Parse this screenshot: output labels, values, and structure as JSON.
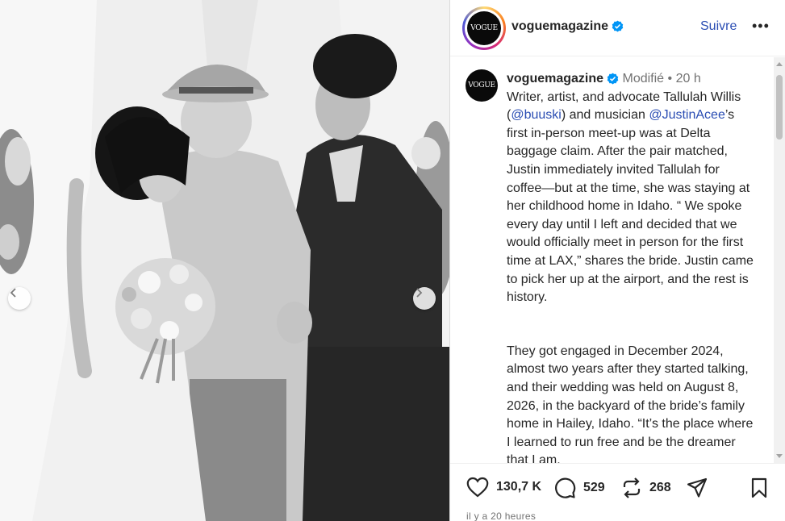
{
  "header": {
    "avatar_text": "VOGUE",
    "username": "voguemagazine",
    "follow_label": "Suivre",
    "more_label": "•••"
  },
  "caption": {
    "avatar_text": "VOGUE",
    "username": "voguemagazine",
    "edited_label": "Modifié",
    "separator": "•",
    "time_ago": "20 h",
    "p1_a": "Writer, artist, and advocate Tallulah Willis (",
    "mention1": "@buuski",
    "p1_b": ") and musician ",
    "mention2": "@JustinAcee",
    "p1_c": "’s first in-person meet-up was at Delta baggage claim. After the pair matched, Justin immediately invited Tallulah for coffee—but at the time, she was staying at her childhood home in Idaho. “ We spoke every day until I left and decided that we would officially meet in person for the first time at LAX,” shares the bride. Justin came to pick her up at the airport, and the rest is history.",
    "p2": "They got engaged in December 2024, almost two years after they started talking, and their wedding was held on August 8, 2026, in the backyard of the bride’s family home in Hailey, Idaho. “It’s the place where I learned to run free and be the dreamer that I am."
  },
  "actions": {
    "likes": "130,7 K",
    "comments": "529",
    "reposts": "268"
  },
  "footer": {
    "timestamp": "il y a 20 heures"
  },
  "icons": {
    "verified": "verified-badge-icon",
    "like": "heart-icon",
    "comment": "comment-bubble-icon",
    "repost": "repost-icon",
    "share": "paper-plane-icon",
    "save": "bookmark-icon",
    "prev": "chevron-left-icon",
    "next": "chevron-right-icon"
  },
  "colors": {
    "link": "#2a4db3",
    "verified": "#0095f6",
    "muted": "#737373"
  }
}
